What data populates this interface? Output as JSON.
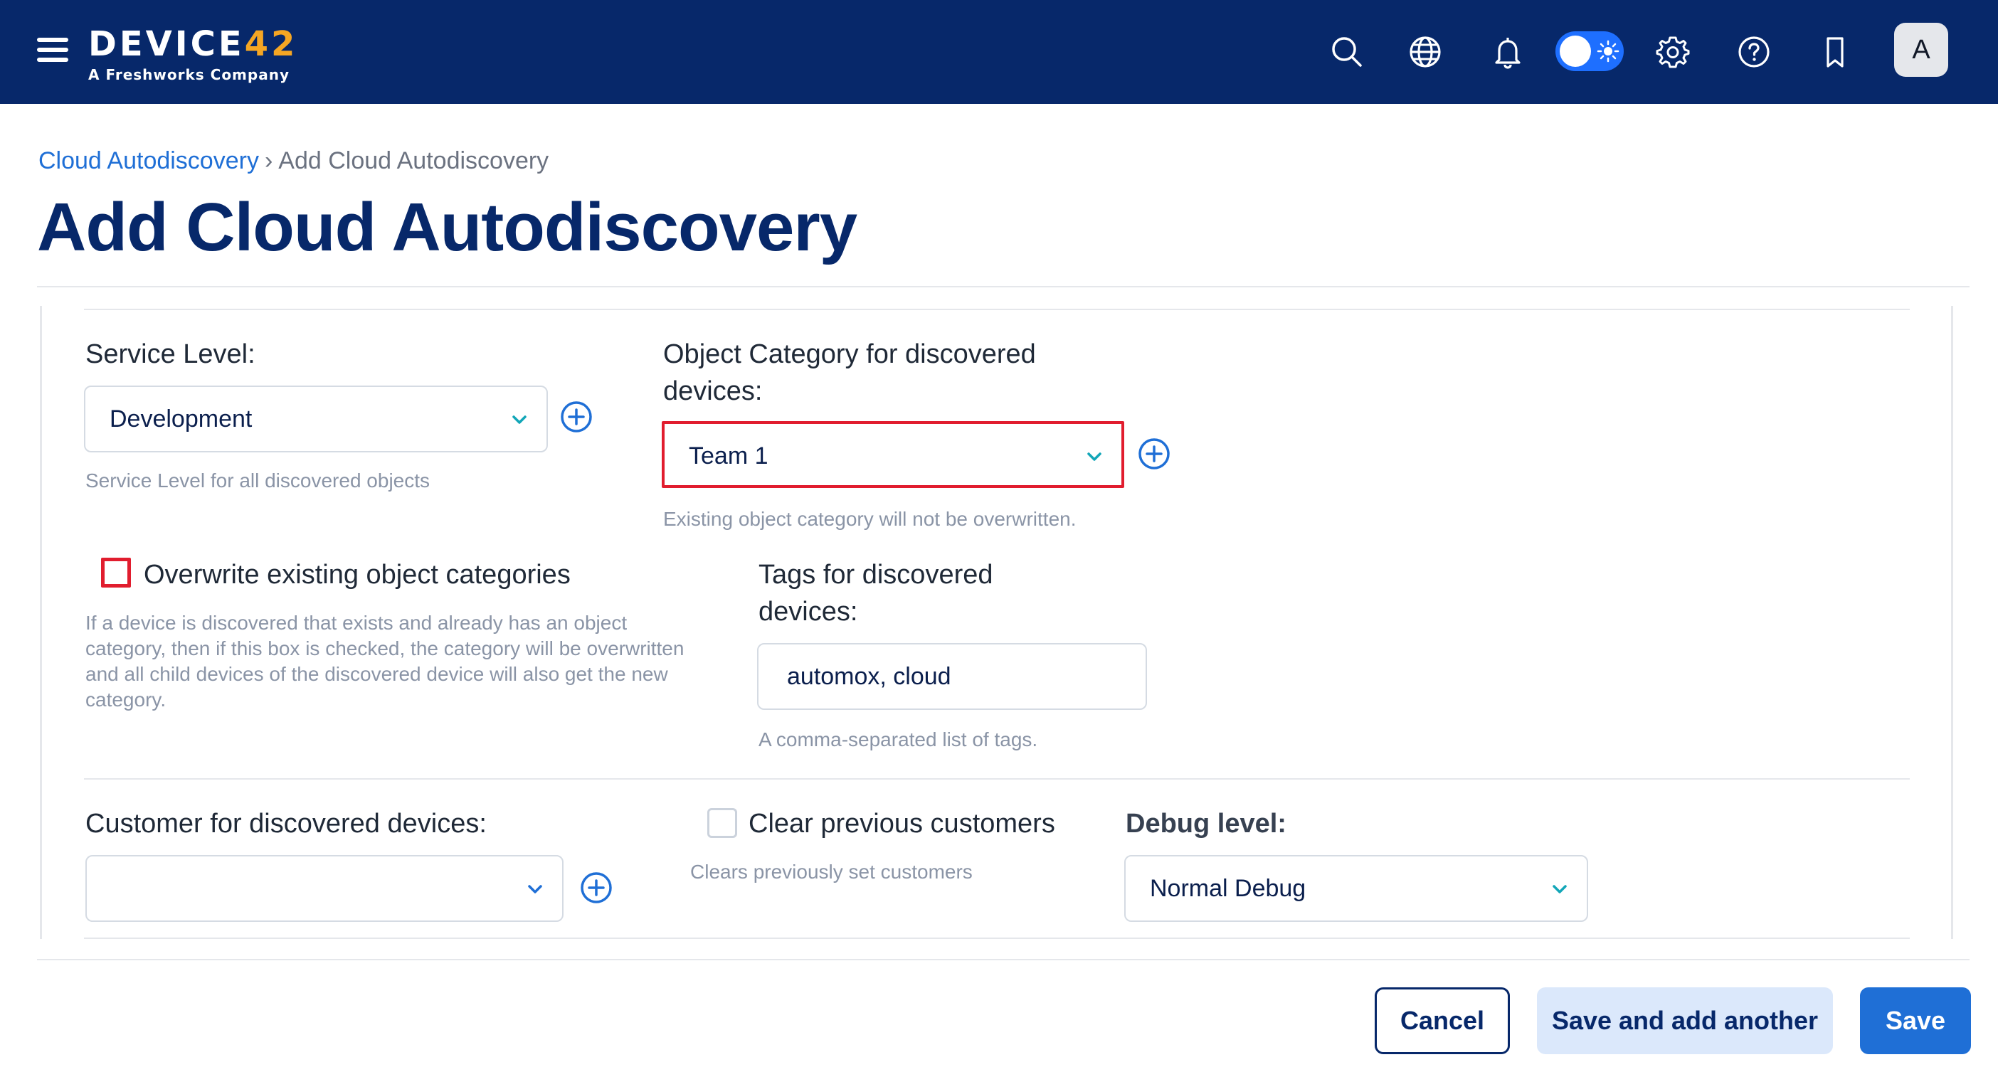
{
  "brand": {
    "logo_prefix": "DEVICE",
    "logo_number": "42",
    "logo_subtitle": "A Freshworks Company",
    "accent_color": "#07286a",
    "logo_number_color": "#f5a623"
  },
  "topnav": {
    "icons": [
      "search-icon",
      "globe-icon",
      "bell-icon",
      "theme-toggle",
      "gear-icon",
      "help-icon",
      "bookmark-icon"
    ],
    "avatar_initial": "A"
  },
  "breadcrumb": {
    "parent": "Cloud Autodiscovery",
    "separator": "›",
    "current": "Add Cloud Autodiscovery"
  },
  "page_title": "Add Cloud Autodiscovery",
  "form": {
    "service_level": {
      "label": "Service Level:",
      "value": "Development",
      "help": "Service Level for all discovered objects"
    },
    "object_category": {
      "label_line1": "Object Category for discovered",
      "label_line2": "devices:",
      "value": "Team 1",
      "help": "Existing object category will not be overwritten.",
      "highlight_color": "#e11d2e"
    },
    "overwrite_categories": {
      "label": "Overwrite existing object categories",
      "checked": false,
      "help_lines": [
        "If a device is discovered that exists and already has an object",
        "category, then if this box is checked, the category will be overwritten",
        "and all child devices of the discovered device will also get the new",
        "category."
      ]
    },
    "tags": {
      "label_line1": "Tags for discovered",
      "label_line2": "devices:",
      "value": "automox, cloud",
      "help": "A comma-separated list of tags."
    },
    "customer": {
      "label": "Customer for discovered devices:",
      "value": ""
    },
    "clear_customers": {
      "label": "Clear previous customers",
      "checked": false,
      "help": "Clears previously set customers"
    },
    "debug_level": {
      "label": "Debug level:",
      "value": "Normal Debug"
    }
  },
  "footer": {
    "cancel": "Cancel",
    "save_and_add": "Save and add another",
    "save": "Save"
  }
}
